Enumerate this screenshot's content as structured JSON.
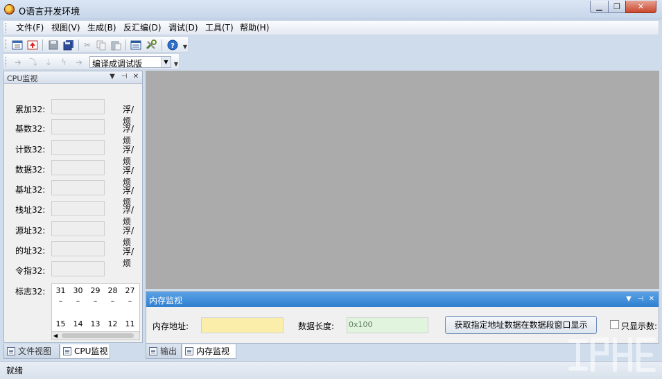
{
  "window": {
    "title": "O语言开发环境",
    "buttons": {
      "minimize": "▁",
      "maximize": "❐",
      "close": "✕"
    }
  },
  "menu": {
    "items": [
      {
        "label": "文件(F)"
      },
      {
        "label": "视图(V)"
      },
      {
        "label": "生成(B)"
      },
      {
        "label": "反汇编(D)"
      },
      {
        "label": "调试(D)"
      },
      {
        "label": "工具(T)"
      },
      {
        "label": "帮助(H)"
      }
    ]
  },
  "toolbar2": {
    "build_mode": "编译成调试版"
  },
  "cpu_panel": {
    "title": "CPU监视",
    "registers": [
      {
        "label": "累加32:",
        "unit": "浮/烦"
      },
      {
        "label": "基数32:",
        "unit": "浮/烦"
      },
      {
        "label": "计数32:",
        "unit": "浮/烦"
      },
      {
        "label": "数据32:",
        "unit": "浮/烦"
      },
      {
        "label": "基址32:",
        "unit": "浮/烦"
      },
      {
        "label": "栈址32:",
        "unit": "浮/烦"
      },
      {
        "label": "源址32:",
        "unit": "浮/烦"
      },
      {
        "label": "的址32:",
        "unit": "浮/烦"
      },
      {
        "label": "令指32:",
        "unit": ""
      }
    ],
    "flags_label": "标志32:",
    "flags_top": [
      "31",
      "30",
      "29",
      "28",
      "27"
    ],
    "flags_dash": [
      "–",
      "–",
      "–",
      "–",
      "–"
    ],
    "flags_bottom": [
      "15",
      "14",
      "13",
      "12",
      "11"
    ]
  },
  "left_tabs": [
    {
      "label": "文件视图"
    },
    {
      "label": "CPU监视"
    }
  ],
  "memory_panel": {
    "title": "内存监视",
    "addr_label": "内存地址:",
    "len_label": "数据长度:",
    "len_value": "0x100",
    "fetch_button": "获取指定地址数据在数据段窗口显示",
    "only_show_label": "只显示数:"
  },
  "bottom_tabs": [
    {
      "label": "输出"
    },
    {
      "label": "内存监视"
    }
  ],
  "status": {
    "text": "就绪"
  },
  "panel_buttons": {
    "dropdown": "▼",
    "pin": "⊣",
    "close": "✕"
  },
  "colors": {
    "mdi_background": "#ababab",
    "memory_header": "#3a8ad8",
    "address_field": "#fbeeab",
    "length_field": "#e0f4de"
  }
}
